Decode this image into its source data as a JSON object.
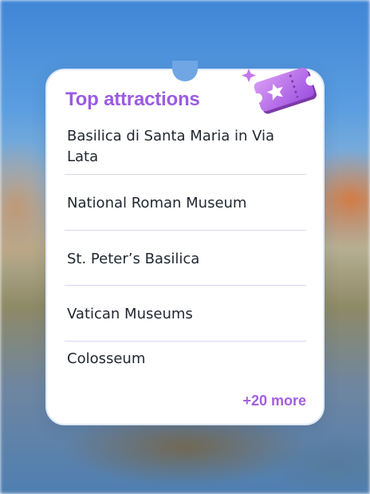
{
  "card": {
    "title": "Top attractions",
    "ticket_icon": "ticket-star-icon",
    "items": [
      {
        "label": "Basilica di Santa Maria in Via Lata"
      },
      {
        "label": "National Roman Museum"
      },
      {
        "label": "St. Peter’s Basilica"
      },
      {
        "label": "Vatican Museums"
      },
      {
        "label": "Colosseum"
      }
    ],
    "more_link": "+20 more"
  },
  "colors": {
    "title": "#9b5ce0",
    "more": "#a45ee0",
    "text": "#222831",
    "divider": "#ddd4ef",
    "ticket": "#b565e6"
  }
}
